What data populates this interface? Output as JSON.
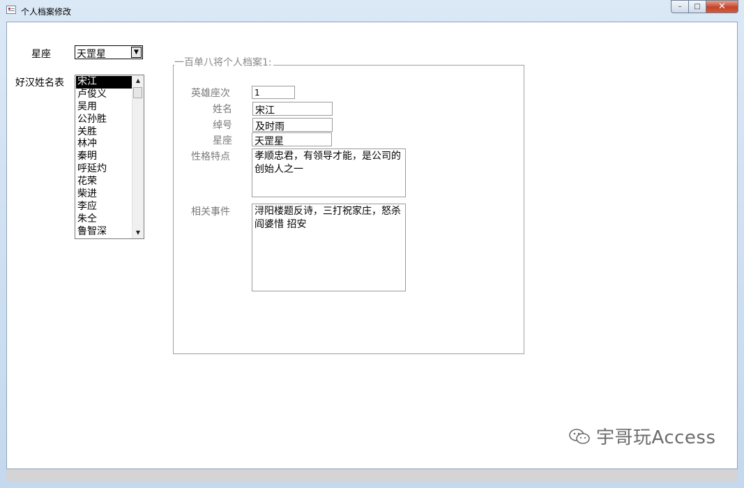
{
  "window": {
    "title": "个人档案修改",
    "controls": {
      "minimize": "–",
      "maximize": "□",
      "close": "✕"
    }
  },
  "filter": {
    "constellation_label": "星座",
    "constellation_value": "天罡星",
    "dropdown_glyph": "▼",
    "list_label": "好汉姓名表",
    "list_items": [
      "宋江",
      "卢俊义",
      "吴用",
      "公孙胜",
      "关胜",
      "林冲",
      "秦明",
      "呼延灼",
      "花荣",
      "柴进",
      "李应",
      "朱仝",
      "鲁智深"
    ],
    "selected_index": 0,
    "scroll_up_glyph": "▲",
    "scroll_down_glyph": "▼"
  },
  "record": {
    "caption": "一百单八将个人档案1:",
    "rank_label": "英雄座次",
    "rank_value": "1",
    "name_label": "姓名",
    "name_value": "宋江",
    "nickname_label": "绰号",
    "nickname_value": "及时雨",
    "constellation_label": "星座",
    "constellation_value": "天罡星",
    "traits_label": "性格特点",
    "traits_value": "孝顺忠君，有领导才能，是公司的创始人之一",
    "events_label": "相关事件",
    "events_value": "浔阳楼题反诗，三打祝家庄，怒杀阎婆惜 招安"
  },
  "watermark": {
    "text": "宇哥玩Access",
    "icon": "wechat-icon"
  }
}
